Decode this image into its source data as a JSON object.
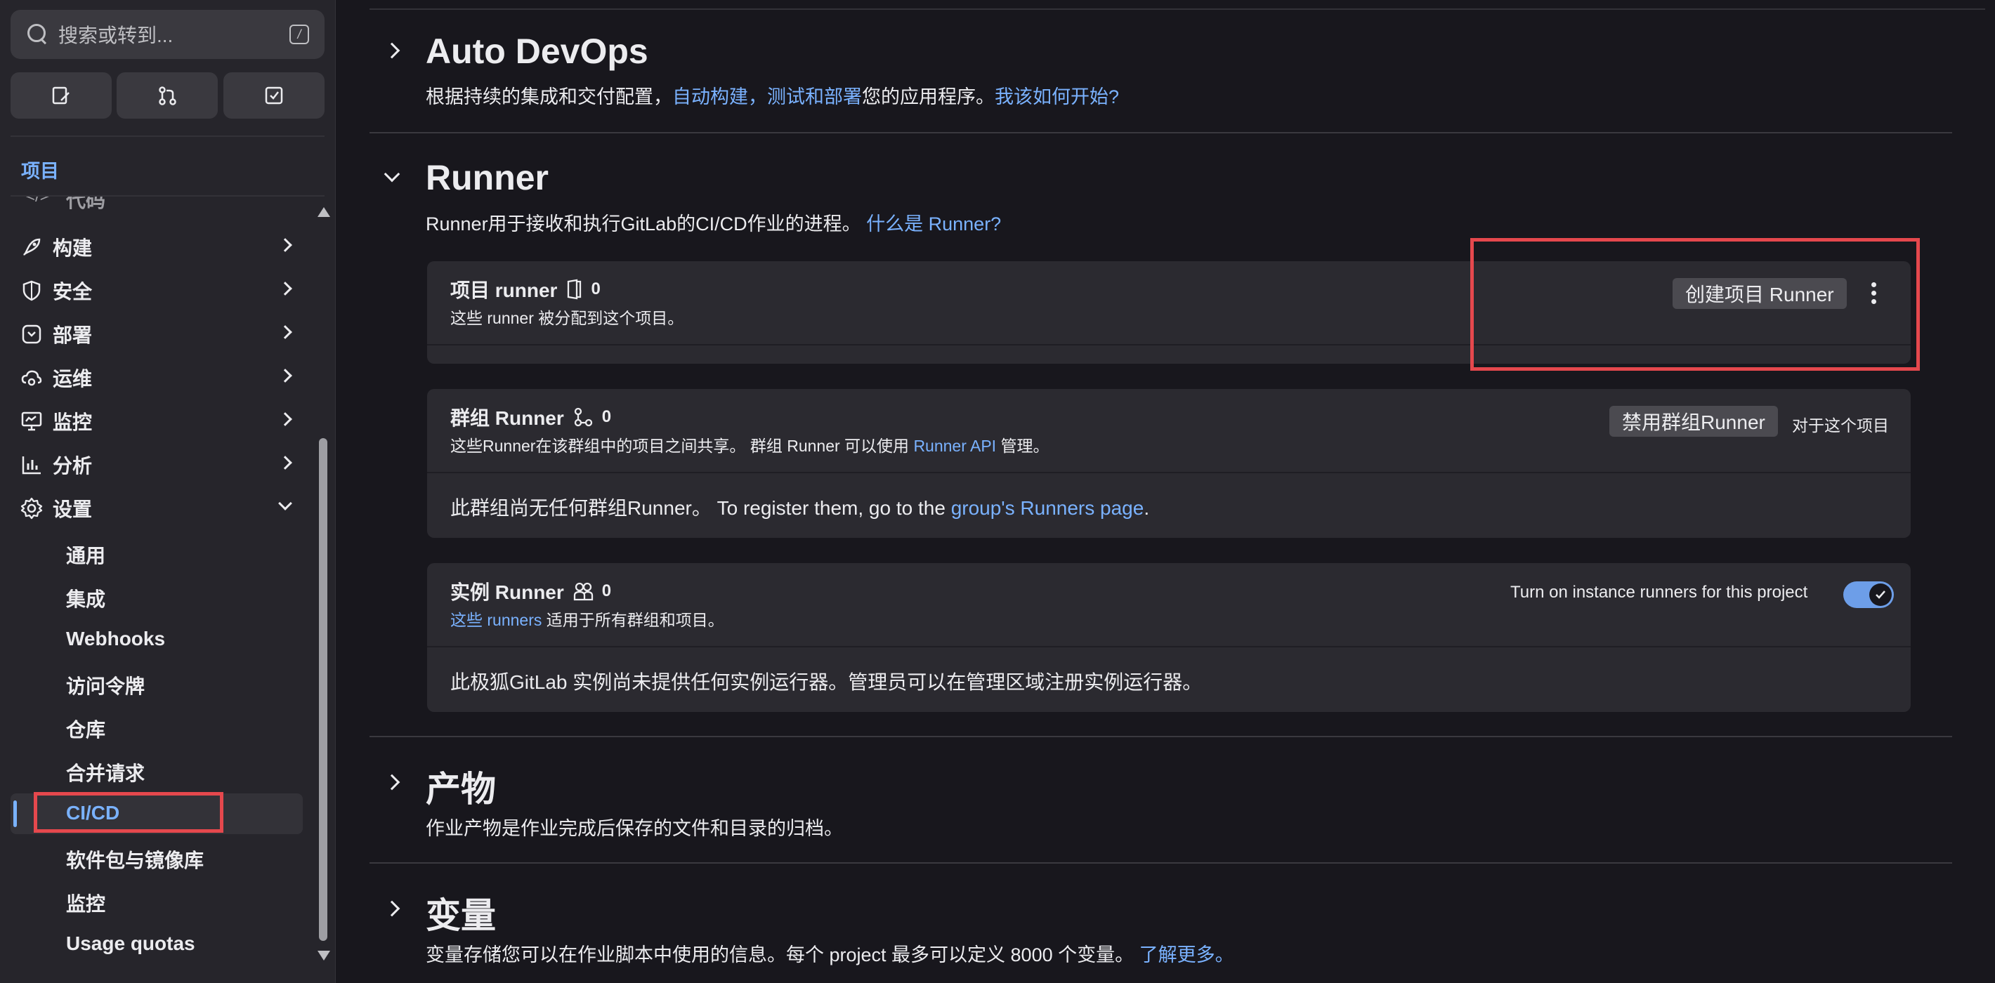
{
  "sidebar": {
    "search_placeholder": "搜索或转到...",
    "search_shortcut": "/",
    "quick_actions": [
      "issues-icon",
      "merge-request-icon",
      "todo-icon"
    ],
    "section_title": "项目",
    "partial_item": "代码",
    "items": [
      {
        "label": "构建",
        "icon": "rocket-icon"
      },
      {
        "label": "安全",
        "icon": "shield-icon"
      },
      {
        "label": "部署",
        "icon": "deploy-icon"
      },
      {
        "label": "运维",
        "icon": "cloud-gear-icon"
      },
      {
        "label": "监控",
        "icon": "monitor-icon"
      },
      {
        "label": "分析",
        "icon": "chart-icon"
      },
      {
        "label": "设置",
        "icon": "gear-icon"
      }
    ],
    "settings_items": [
      "通用",
      "集成",
      "Webhooks",
      "访问令牌",
      "仓库",
      "合并请求",
      "CI/CD",
      "软件包与镜像库",
      "监控",
      "Usage quotas"
    ],
    "active_item": "CI/CD"
  },
  "main": {
    "auto_devops": {
      "title": "Auto DevOps",
      "desc_prefix": "根据持续的集成和交付配置，",
      "link1": "自动构建，测试和部署",
      "desc_middle": "您的应用程序。",
      "link2": "我该如何开始?"
    },
    "runner": {
      "title": "Runner",
      "desc": "Runner用于接收和执行GitLab的CI/CD作业的进程。",
      "link": "什么是 Runner?",
      "project": {
        "title": "项目 runner",
        "count": "0",
        "subtitle": "这些 runner 被分配到这个项目。",
        "button": "创建项目 Runner"
      },
      "group": {
        "title": "群组 Runner",
        "count": "0",
        "subtitle_prefix": "这些Runner在该群组中的项目之间共享。 群组 Runner 可以使用 ",
        "subtitle_link": "Runner API",
        "subtitle_suffix": " 管理。",
        "button": "禁用群组Runner",
        "button_note": "对于这个项目",
        "body_prefix": "此群组尚无任何群组Runner。 To register them, go to the ",
        "body_link": "group's Runners page",
        "body_suffix": "."
      },
      "instance": {
        "title": "实例 Runner",
        "count": "0",
        "subtitle_prefix": "这些 ",
        "subtitle_link": "runners",
        "subtitle_suffix": " 适用于所有群组和项目。",
        "toggle_label": "Turn on instance runners for this project",
        "toggle_on": true,
        "body": "此极狐GitLab 实例尚未提供任何实例运行器。管理员可以在管理区域注册实例运行器。"
      }
    },
    "artifacts": {
      "title": "产物",
      "desc": "作业产物是作业完成后保存的文件和目录的归档。"
    },
    "variables": {
      "title": "变量",
      "desc": "变量存储您可以在作业脚本中使用的信息。每个 project 最多可以定义 8000 个变量。",
      "link": "了解更多。"
    }
  },
  "colors": {
    "accent": "#7ab2ff",
    "highlight": "#e5484d",
    "toggle": "#6d9ee8"
  }
}
